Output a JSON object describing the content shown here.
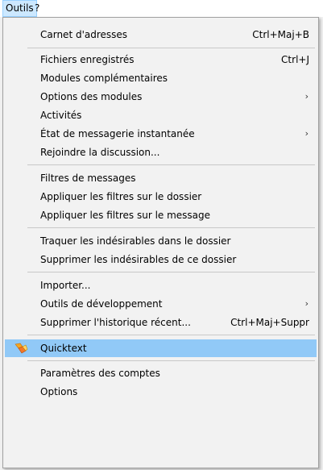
{
  "menubar": {
    "outils": "Outils",
    "help": "?"
  },
  "menu": {
    "carnet": {
      "label": "Carnet d'adresses",
      "shortcut": "Ctrl+Maj+B"
    },
    "fichiers": {
      "label": "Fichiers enregistrés",
      "shortcut": "Ctrl+J"
    },
    "modules": {
      "label": "Modules complémentaires"
    },
    "options_modules": {
      "label": "Options des modules"
    },
    "activites": {
      "label": "Activités"
    },
    "etat": {
      "label": "État de messagerie instantanée"
    },
    "rejoindre": {
      "label": "Rejoindre la discussion..."
    },
    "filtres": {
      "label": "Filtres de messages"
    },
    "appliquer_dossier": {
      "label": "Appliquer les filtres sur le dossier"
    },
    "appliquer_message": {
      "label": "Appliquer les filtres sur le message"
    },
    "traquer": {
      "label": "Traquer les indésirables dans le dossier"
    },
    "supprimer_indes": {
      "label": "Supprimer les indésirables de ce dossier"
    },
    "importer": {
      "label": "Importer..."
    },
    "outils_dev": {
      "label": "Outils de développement"
    },
    "supprimer_hist": {
      "label": "Supprimer l'historique récent...",
      "shortcut": "Ctrl+Maj+Suppr"
    },
    "quicktext": {
      "label": "Quicktext",
      "icon": "quicktext-icon"
    },
    "parametres": {
      "label": "Paramètres des comptes"
    },
    "options": {
      "label": "Options"
    }
  },
  "colors": {
    "highlight": "#91c9f7",
    "menubar_active": "#cce8ff"
  }
}
